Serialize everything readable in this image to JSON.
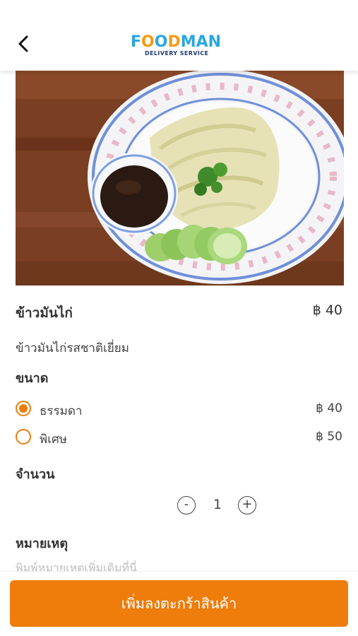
{
  "header": {
    "back_icon": "chevron-left-icon",
    "logo": {
      "text_main": "FOODMAN",
      "text_sub": "DELIVERY SERVICE"
    }
  },
  "hero": {
    "image": "hainanese-chicken-rice-plate"
  },
  "item": {
    "name": "ข้าวมันไก่",
    "price": "฿ 40",
    "description": "ข้าวมันไก่รสชาติเยี่ยม"
  },
  "size": {
    "heading": "ขนาด",
    "options": [
      {
        "label": "ธรรมดา",
        "price": "฿ 40",
        "selected": true
      },
      {
        "label": "พิเศษ",
        "price": "฿ 50",
        "selected": false
      }
    ]
  },
  "quantity": {
    "heading": "จำนวน",
    "minus": "-",
    "value": "1",
    "plus": "+"
  },
  "note": {
    "heading": "หมายเหตุ",
    "placeholder": "พิมพ์หมายเหตุเพิ่มเติมที่นี่"
  },
  "cta": {
    "label": "เพิ่มลงตะกร้าสินค้า"
  },
  "colors": {
    "accent": "#ee7d0c",
    "logo_blue": "#2aa7e0",
    "logo_orange": "#f39c12"
  }
}
